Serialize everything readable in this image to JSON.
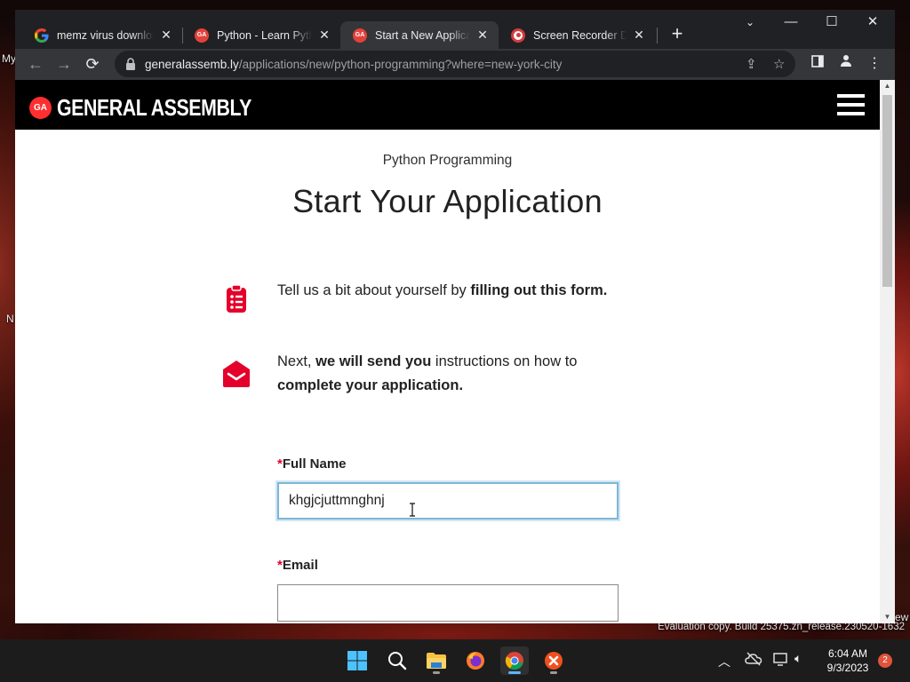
{
  "desktop": {
    "left_label_1": "My",
    "left_label_2": "N",
    "right_label": "ew",
    "watermark": "Evaluation copy. Build 25375.zn_release.230520-1632"
  },
  "tabs": [
    {
      "title": "memz virus download",
      "favicon": "google-icon",
      "active": false
    },
    {
      "title": "Python - Learn Python",
      "favicon": "ga-icon",
      "active": false
    },
    {
      "title": "Start a New Application",
      "favicon": "ga-icon",
      "active": true
    },
    {
      "title": "Screen Recorder Download",
      "favicon": "recorder-icon",
      "active": false
    }
  ],
  "address_bar": {
    "host": "generalassemb.ly",
    "path": "/applications/new/python-programming?where=new-york-city"
  },
  "site": {
    "logo_mark": "GA",
    "logo_text": "GENERAL ASSEMBLY"
  },
  "page": {
    "program": "Python Programming",
    "title": "Start Your Application",
    "step1": {
      "pre": "Tell us a bit about yourself by ",
      "bold": "filling out this form."
    },
    "step2": {
      "pre": "Next, ",
      "bold1": "we will send you",
      "mid": " instructions on how to",
      "bold2": "complete your application."
    }
  },
  "form": {
    "required_marker": "*",
    "full_name_label": "Full Name",
    "full_name_value": "khgjcjuttmnghnj",
    "email_label": "Email",
    "email_value": ""
  },
  "taskbar": {
    "time": "6:04 AM",
    "date": "9/3/2023",
    "notifications": "2"
  },
  "colors": {
    "brand_red": "#ff2f2f",
    "required_red": "#e4002b",
    "focus_blue": "#7fb6d6"
  }
}
